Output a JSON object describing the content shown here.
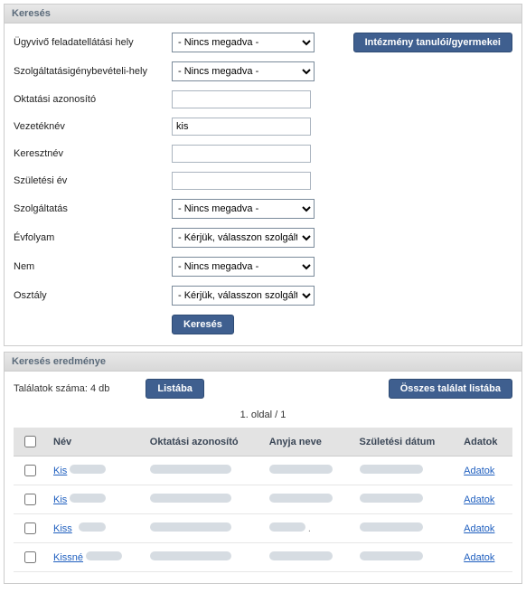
{
  "search_panel": {
    "title": "Keresés",
    "top_button": "Intézmény tanulói/gyermekei",
    "not_given": "- Nincs megadva -",
    "choose_service": "- Kérjük, válasszon szolgálta",
    "fields": {
      "ugyvivo": "Ügyvivő feladatellátási hely",
      "szolg_hely": "Szolgáltatásigénybevételi-hely",
      "oktatasi_az": "Oktatási azonosító",
      "vezeteknev": "Vezetéknév",
      "keresztnev": "Keresztnév",
      "szuletesi_ev": "Születési év",
      "szolgaltatas": "Szolgáltatás",
      "evfolyam": "Évfolyam",
      "nem": "Nem",
      "osztaly": "Osztály"
    },
    "values": {
      "vezeteknev": "kis"
    },
    "submit": "Keresés"
  },
  "results_panel": {
    "title": "Keresés eredménye",
    "count_label": "Találatok száma: 4 db",
    "to_list_btn": "Listába",
    "all_to_list_btn": "Összes találat listába",
    "pager": "1. oldal / 1",
    "columns": {
      "name": "Név",
      "okt_id": "Oktatási azonosító",
      "mother": "Anyja neve",
      "birth": "Születési dátum",
      "data": "Adatok"
    },
    "rows": [
      {
        "name": "Kis",
        "data_link": "Adatok"
      },
      {
        "name": "Kis",
        "data_link": "Adatok"
      },
      {
        "name": "Kiss",
        "data_link": "Adatok"
      },
      {
        "name": "Kissné",
        "data_link": "Adatok"
      }
    ]
  }
}
